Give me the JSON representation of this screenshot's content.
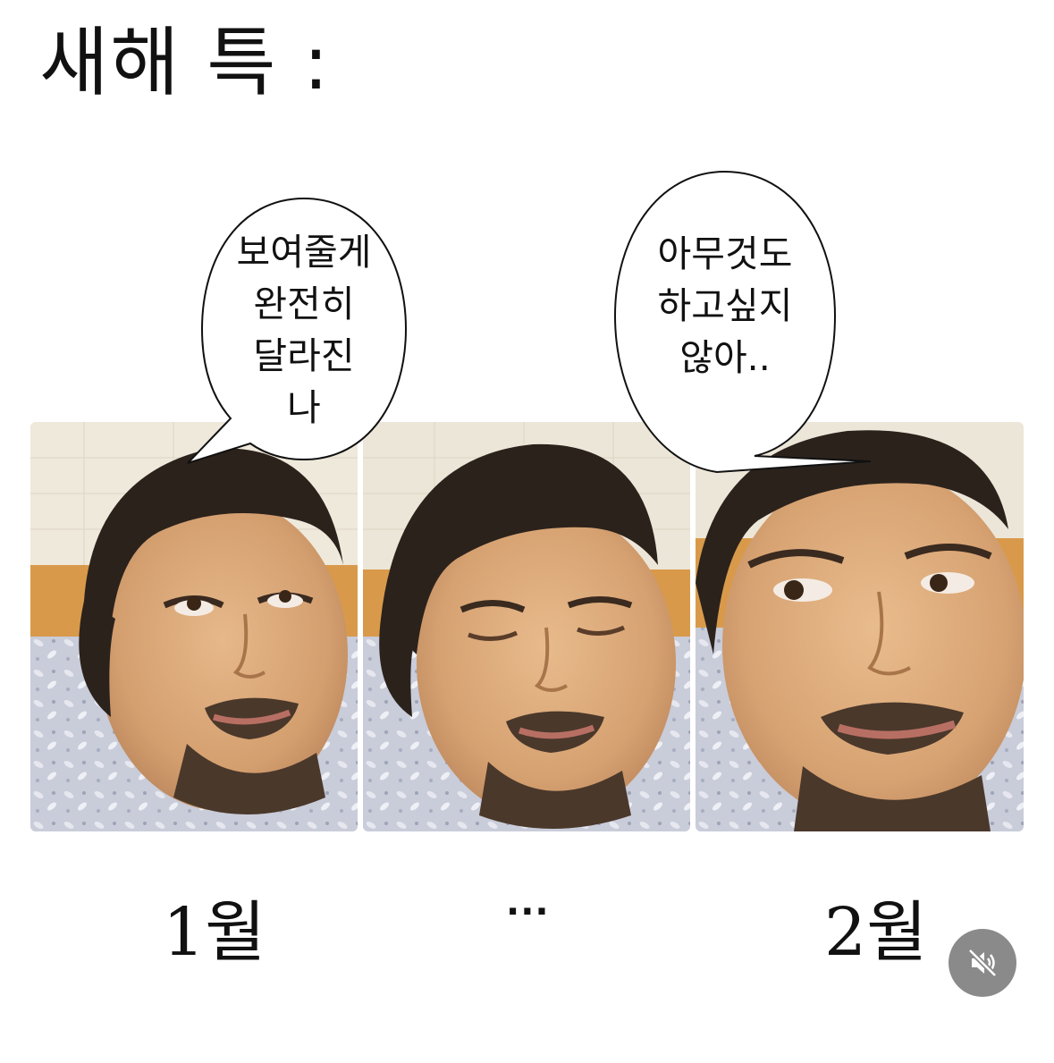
{
  "title": "새해 특 :",
  "bubbles": [
    {
      "lines": [
        "보여줄게",
        "완전히",
        "달라진",
        "나"
      ]
    },
    {
      "lines": [
        "아무것도",
        "하고싶지",
        "않아.."
      ]
    }
  ],
  "labels": {
    "first": "1월",
    "middle": "···",
    "last": "2월"
  },
  "icons": {
    "mute": "speaker-muted-icon"
  },
  "colors": {
    "background": "#ffffff",
    "text": "#111111",
    "mute_button": "#8a8a8a"
  }
}
